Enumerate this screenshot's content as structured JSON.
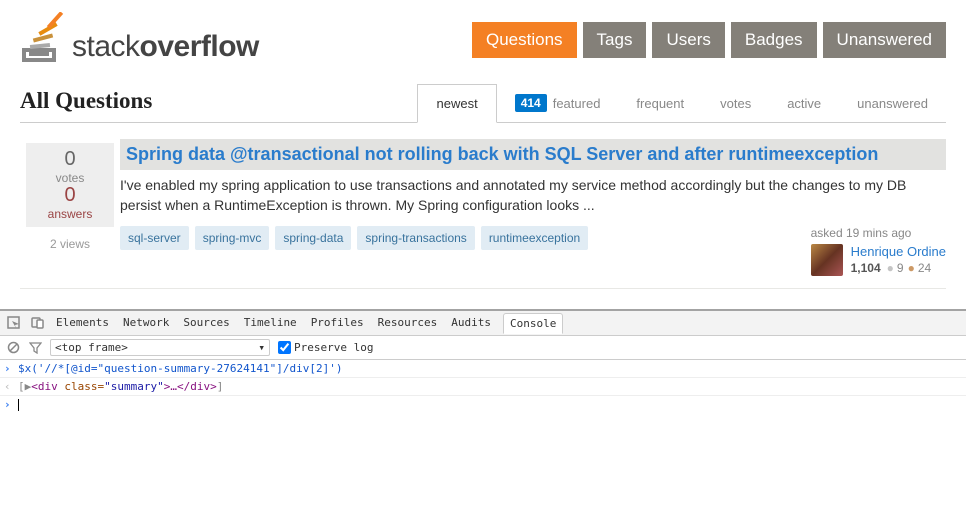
{
  "logo": {
    "text1": "stack",
    "text2": "overflow"
  },
  "nav": [
    "Questions",
    "Tags",
    "Users",
    "Badges",
    "Unanswered"
  ],
  "nav_active": 0,
  "page_title": "All Questions",
  "sort_tabs": [
    {
      "label": "newest",
      "badge": null,
      "active": true
    },
    {
      "label": "featured",
      "badge": "414",
      "active": false
    },
    {
      "label": "frequent",
      "badge": null,
      "active": false
    },
    {
      "label": "votes",
      "badge": null,
      "active": false
    },
    {
      "label": "active",
      "badge": null,
      "active": false
    },
    {
      "label": "unanswered",
      "badge": null,
      "active": false
    }
  ],
  "question": {
    "votes": "0",
    "votes_label": "votes",
    "answers": "0",
    "answers_label": "answers",
    "views": "2 views",
    "title": "Spring data @transactional not rolling back with SQL Server and after runtimeexception",
    "excerpt": "I've enabled my spring application to use transactions and annotated my service method accordingly but the changes to my DB persist when a RuntimeException is thrown. My Spring configuration looks ...",
    "tags": [
      "sql-server",
      "spring-mvc",
      "spring-data",
      "spring-transactions",
      "runtimeexception"
    ],
    "asked": "asked 19 mins ago",
    "user_name": "Henrique Ordine",
    "rep": "1,104",
    "silver": "9",
    "bronze": "24"
  },
  "devtools": {
    "tabs": [
      "Elements",
      "Network",
      "Sources",
      "Timeline",
      "Profiles",
      "Resources",
      "Audits",
      "Console"
    ],
    "active_tab": 7,
    "frame": "<top frame>",
    "preserve_label": "Preserve log",
    "cmd": "$x('//*[@id=\"question-summary-27624141\"]/div[2]')",
    "result_open": "[▶",
    "result_tag": "<div ",
    "result_attr": "class=",
    "result_val": "\"summary\"",
    "result_rest": ">…</div>",
    "result_close": "]"
  }
}
